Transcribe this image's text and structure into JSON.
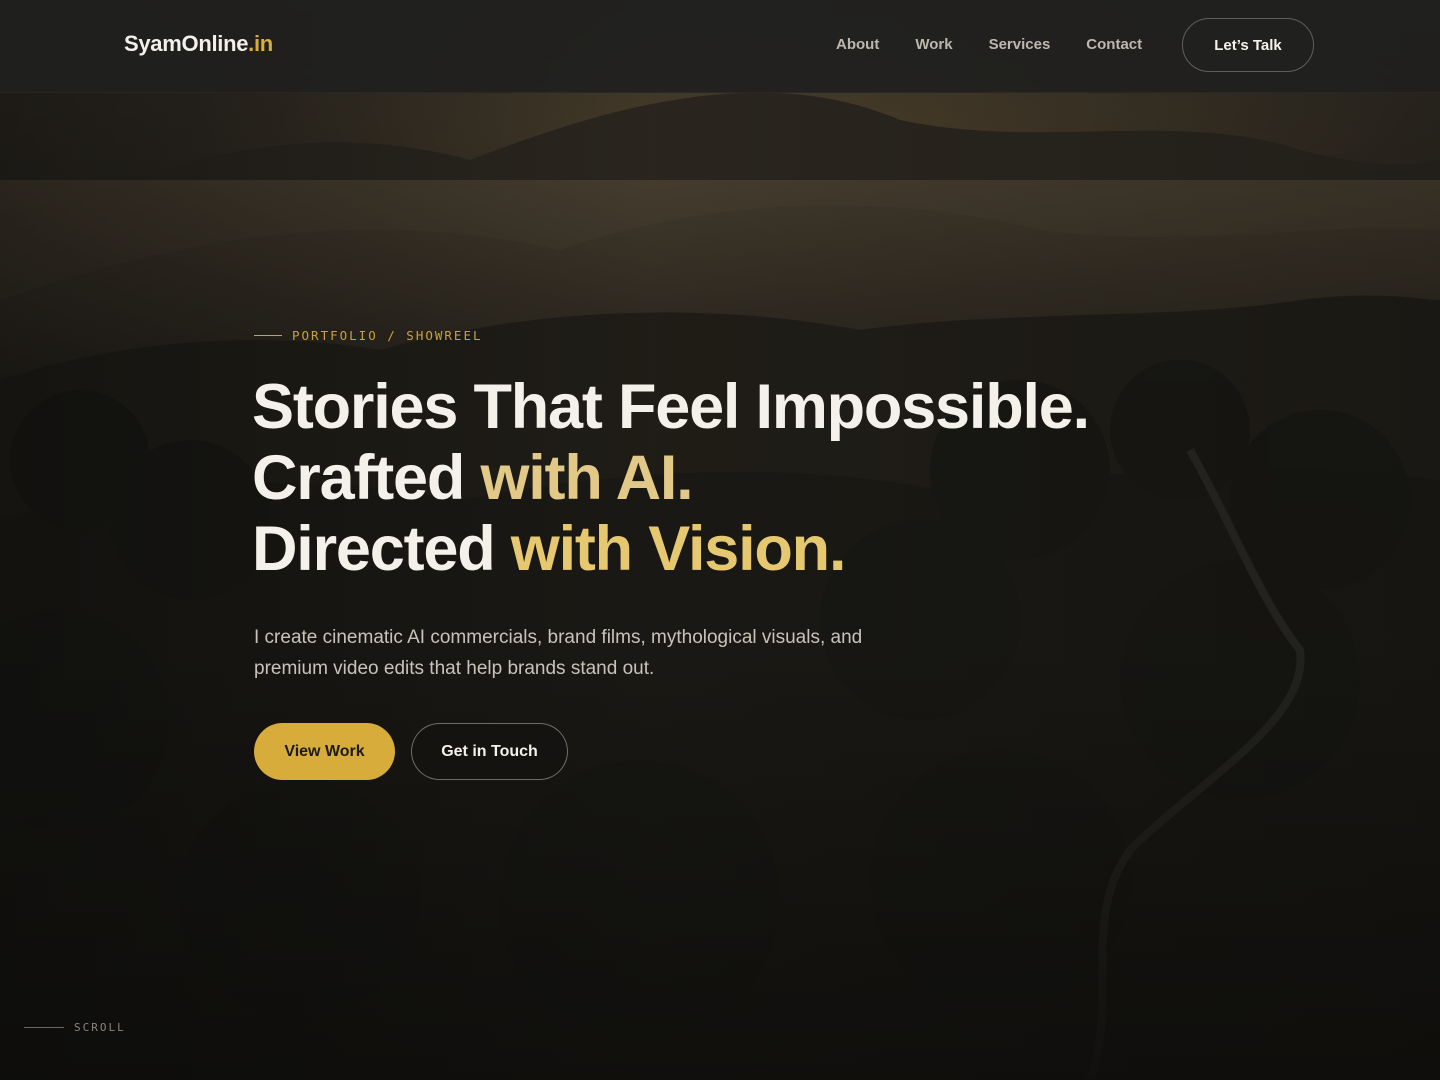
{
  "brand": {
    "name": "SyamOnline",
    "suffix": ".in",
    "accent_color": "#d9ad3c"
  },
  "nav": {
    "items": [
      {
        "label": "About"
      },
      {
        "label": "Work"
      },
      {
        "label": "Services"
      },
      {
        "label": "Contact"
      }
    ],
    "cta_label": "Let’s Talk"
  },
  "hero": {
    "eyebrow": "PORTFOLIO / SHOWREEL",
    "headline": {
      "line1": "Stories That Feel Impossible.",
      "line2_prefix": "Crafted ",
      "line2_accent": "with AI.",
      "line3_prefix": "Directed ",
      "line3_accent": "with Vision."
    },
    "subtitle": "I create cinematic AI commercials, brand films, mythological visuals, and premium video edits that help brands stand out.",
    "primary_button": "View Work",
    "secondary_button": "Get in Touch",
    "background_image": "misty-forest-landscape"
  },
  "scroll_indicator": "SCROLL",
  "colors": {
    "background": "#141312",
    "gold": "#d8ac3a",
    "text": "#f4f1ea"
  }
}
